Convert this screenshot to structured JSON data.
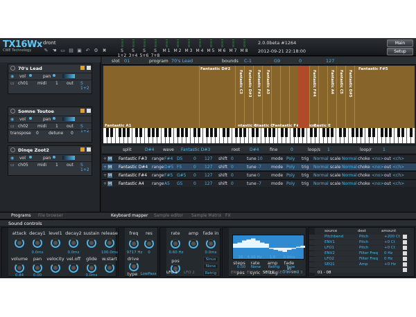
{
  "header": {
    "logo": "TX16Wx",
    "logo_sub": "CWE Technology",
    "patch_name": "dront",
    "version": "2.0.0beta #1264",
    "datetime": "2012-09-21 22:18:00",
    "outputs": [
      "S 1+2",
      "S 3+4",
      "S 5+6",
      "S 7+8",
      "M 1",
      "M 2",
      "M 3",
      "M 4",
      "M 5",
      "M 6",
      "M 7",
      "M 8"
    ],
    "main_btn": "Main",
    "setup_btn": "Setup"
  },
  "programs": [
    {
      "name": "70's Lead",
      "vol": "vol",
      "pan": "pan",
      "ch": "ch01",
      "midi": "midi",
      "mval": "1",
      "out": "out",
      "oval": "S 1+2"
    },
    {
      "name": "Somne Toutoe",
      "vol": "vol",
      "pan": "pan",
      "ch": "ch02",
      "midi": "midi",
      "mval": "1",
      "out": "out",
      "oval": "S 1+2",
      "transpose": "transpose",
      "tval": "0",
      "detune": "detune",
      "dval": "0"
    },
    {
      "name": "Dinqe Zoot2",
      "vol": "vol",
      "pan": "pan",
      "ch": "ch05",
      "midi": "midi",
      "mval": "1",
      "out": "out",
      "oval": "S 1+2"
    }
  ],
  "left_tabs": {
    "programs": "Programs",
    "browser": "File browser"
  },
  "kb_tabs": {
    "mapper": "Keyboard mapper",
    "sample": "Sample editor",
    "matrix": "Sample Matrix",
    "fx": "FX"
  },
  "kbtop": {
    "slot": "slot",
    "slot_v": "01",
    "program": "program",
    "program_v": "70's Lead",
    "bounds": "bounds",
    "b1": "C-1",
    "b2": "G9",
    "b3": "0",
    "b4": "127"
  },
  "zones": {
    "a1": "Fantastic A1",
    "d2": "Fantastic D#2",
    "f3": "Fantastic F#3",
    "f5": "Fantastic F#5",
    "mc1": "ntastic C",
    "mc2": "ntastic C",
    "mc3": "ntastic C",
    "mc4": "ntastic E",
    "v": [
      "Fantastic C3",
      "Fantastic D#3",
      "Fantastic F#3",
      "Fantastic A3",
      "Fantastic D#4",
      "Fantastic F#4",
      "Fantastic A4",
      "Fantastic C5",
      "Fantastic D#5"
    ]
  },
  "zhead": {
    "split": "split",
    "split_v": "D#4",
    "wave": "wave",
    "wave_v": "Fantastic D#3",
    "root": "root",
    "root_v": "D#4",
    "fine": "fine",
    "fine_v": "0",
    "loops": "loop/s",
    "loops_v": "1",
    "loopr": "loop/r",
    "loopr_v": "1"
  },
  "zrows": [
    {
      "n": "Fantastic F#3",
      "r": "range",
      "lo": "F#4",
      "hi": "D5",
      "a": "0",
      "b": "127",
      "sh": "shift",
      "s": "0",
      "tu": "tune",
      "t": "10",
      "m": "mode",
      "mv": "Poly",
      "tr": "trig",
      "tv": "Normal",
      "sc": "scale",
      "sv": "Normal",
      "ch": "choke",
      "cv": "<no>",
      "o1": "out",
      "o2": "<ch>"
    },
    {
      "n": "Fantastic D#4",
      "r": "range",
      "lo": "D#5",
      "hi": "F5",
      "a": "0",
      "b": "127",
      "sh": "shift",
      "s": "0",
      "tu": "tune",
      "t": "-7",
      "m": "mode",
      "mv": "Poly",
      "tr": "trig",
      "tv": "Normal",
      "sc": "scale",
      "sv": "Normal",
      "ch": "choke",
      "cv": "<no>",
      "o1": "out",
      "o2": "<ch>"
    },
    {
      "n": "Fantastic F#4",
      "r": "range",
      "lo": "F#5",
      "hi": "G#5",
      "a": "0",
      "b": "127",
      "sh": "shift",
      "s": "0",
      "tu": "tune",
      "t": "0",
      "m": "mode",
      "mv": "Poly",
      "tr": "trig",
      "tv": "Normal",
      "sc": "scale",
      "sv": "Normal",
      "ch": "choke",
      "cv": "<no>",
      "o1": "out",
      "o2": "<ch>"
    },
    {
      "n": "Fantastic A4",
      "r": "range",
      "lo": "A5",
      "hi": "G5",
      "a": "0",
      "b": "127",
      "sh": "shift",
      "s": "0",
      "tu": "tune",
      "t": "-7",
      "m": "mode",
      "mv": "Poly",
      "tr": "trig",
      "tv": "Normal",
      "sc": "scale",
      "sv": "Normal",
      "ch": "choke",
      "cv": "<no>",
      "o1": "out",
      "o2": "<ch>"
    }
  ],
  "sound": {
    "title": "Sound controls",
    "env": {
      "labels1": [
        "attack",
        "decay1",
        "level1",
        "decay2",
        "sustain",
        "release"
      ],
      "vals1": [
        "",
        "0.0ms",
        "",
        "0.0ms",
        "",
        "100.0ms"
      ],
      "labels2": [
        "volume",
        "pan",
        "velocity",
        "vel.off",
        "glide",
        "w.start"
      ],
      "vals2": [
        "0.84",
        "0.00",
        "",
        "",
        "0.0ms",
        ""
      ]
    },
    "filt": {
      "freq": "freq",
      "res": "res",
      "freq_v": "9717 Hz",
      "res_v": "0",
      "drive": "drive",
      "type": "type",
      "type_v": "LowPass"
    },
    "lfo": {
      "rate": "rate",
      "amp": "amp",
      "fadein": "fade in",
      "rate_v": "0.60 Hz",
      "amp_v": "0.0ms",
      "pos": "pos",
      "shape": "Sinus",
      "mode": "None",
      "retrig": "Retrig",
      "tab1": "LFO 1",
      "tab2": "LFO 2"
    },
    "seq": {
      "steps": "16",
      "rate": "4.00 Hz",
      "amp": "1.0",
      "fadein": "0.0ms",
      "l1": "steps",
      "l2": "rate",
      "l3": "amp",
      "l4": "fade in",
      "p": "0.00",
      "s": "None",
      "r": "Retrig",
      "t": "Type",
      "l5": "pos",
      "l6": "sync",
      "l7": "trig",
      "st": "Stepped",
      "tab1": "ENV 1",
      "tab2": "ENV 2",
      "tab3": "SEQ 1",
      "tab4": "SEQ 2",
      "tab5": "SEQ 3"
    },
    "matrix": {
      "h1": "source",
      "h2": "dest",
      "h3": "amount",
      "rows": [
        [
          "Pitchbend",
          "Pitch",
          "+200 Ct"
        ],
        [
          "ENV1",
          "Pitch",
          "+0 Ct"
        ],
        [
          "LFO1",
          "Pitch",
          "+0 Ct"
        ],
        [
          "ENV2",
          "Filter Freq",
          "0 Hz"
        ],
        [
          "LFO2",
          "Filter Freq",
          "0 Hz"
        ],
        [
          "SEQ1",
          "Amp",
          "+0 Hz"
        ],
        [
          "",
          "",
          ""
        ]
      ],
      "page": "01 - 08"
    }
  }
}
